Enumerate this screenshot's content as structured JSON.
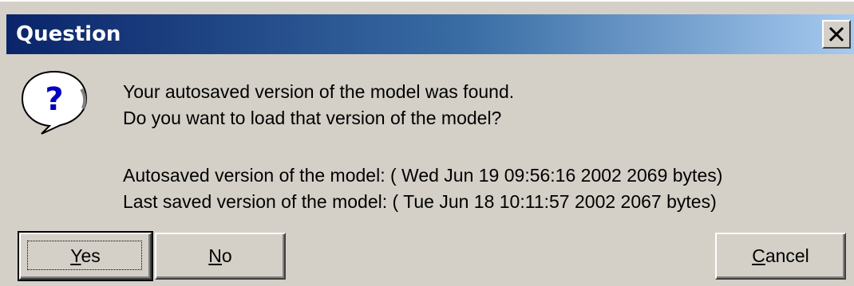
{
  "window": {
    "title": "Question",
    "close_label": "×"
  },
  "icon": {
    "name": "question-icon",
    "glyph": "?",
    "color": "#0000c0"
  },
  "message": {
    "line1": "Your autosaved version of the model was found.",
    "line2": "Do you want to load that version of the model?"
  },
  "details": {
    "autosaved": "Autosaved version of the model: ( Wed Jun 19 09:56:16 2002 2069 bytes)",
    "last_saved": "Last saved version of the model: ( Tue Jun 18 10:11:57 2002 2067 bytes)"
  },
  "buttons": {
    "yes": {
      "mnemonic": "Y",
      "rest": "es"
    },
    "no": {
      "mnemonic": "N",
      "rest": "o"
    },
    "cancel": {
      "mnemonic": "C",
      "rest": "ancel"
    }
  },
  "colors": {
    "title_start": "#0a246a",
    "title_end": "#a6caf0",
    "face": "#d4d0c8"
  }
}
